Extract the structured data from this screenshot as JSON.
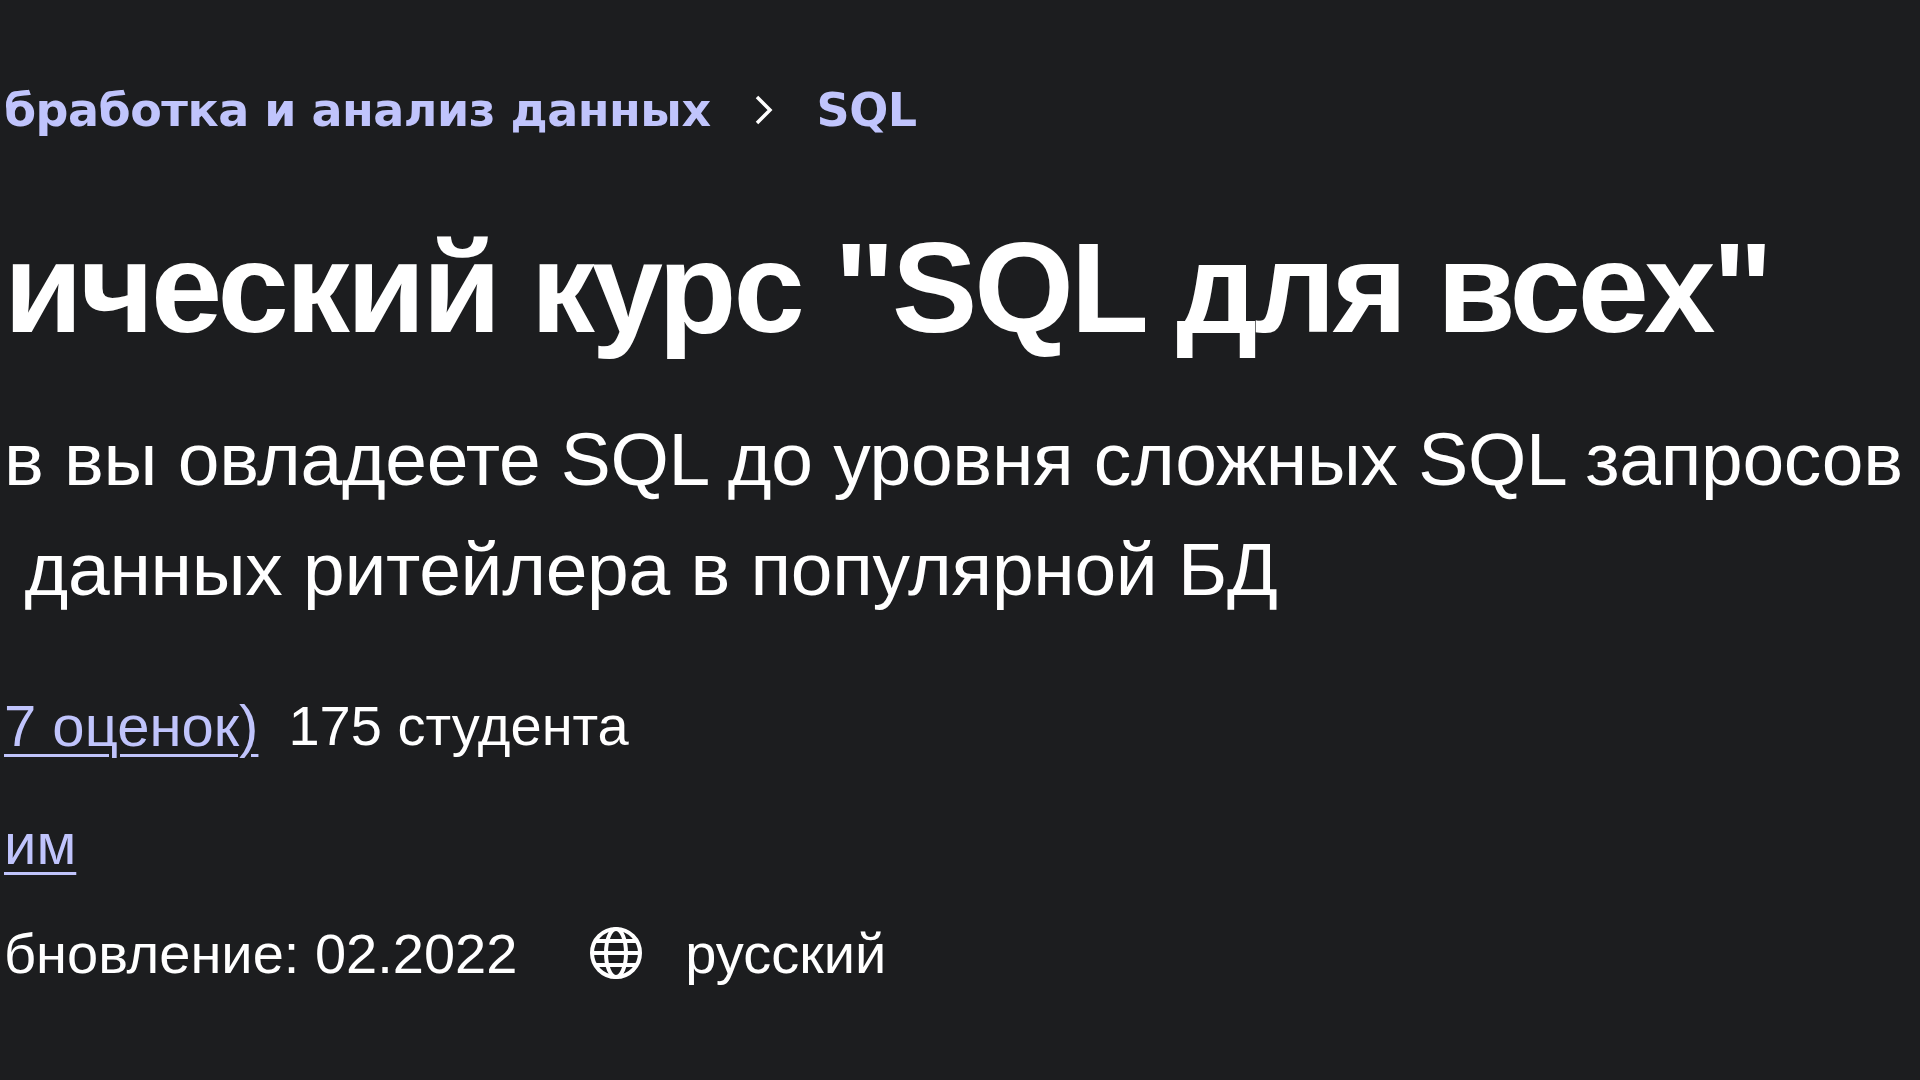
{
  "breadcrumb": [
    {
      "label": "бработка и анализ данных"
    },
    {
      "label": "SQL"
    }
  ],
  "title": "ический курс \"SQL для всех\"",
  "description": "в вы овладеете SQL до уровня сложных SQL запросов\n данных ритейлера в популярной БД",
  "ratings_link": "7 оценок)",
  "students": "175 студента",
  "author_link": "им",
  "last_updated": "бновление: 02.2022",
  "language": "русский"
}
